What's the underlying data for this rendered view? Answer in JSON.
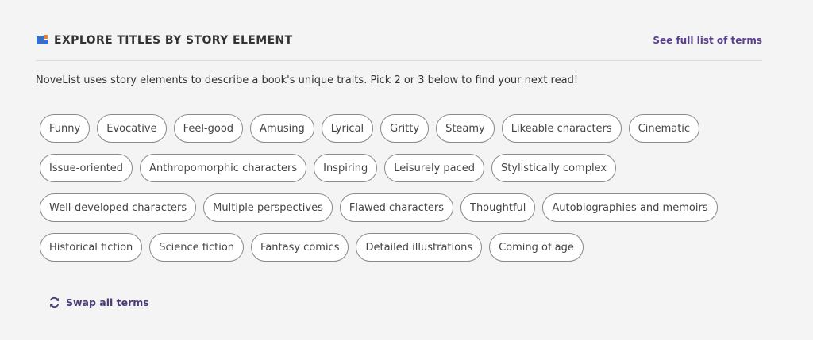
{
  "header": {
    "title": "EXPLORE TITLES BY STORY ELEMENT",
    "see_full_label": "See full list of terms",
    "icon": "book-icon"
  },
  "description": "NoveList uses story elements to describe a book's unique traits. Pick 2 or 3 below to find your next read!",
  "chips": {
    "row1": [
      "Funny",
      "Evocative",
      "Feel-good",
      "Amusing",
      "Lyrical",
      "Gritty",
      "Steamy",
      "Likeable characters",
      "Cinematic"
    ],
    "row2": [
      "Issue-oriented",
      "Anthropomorphic characters",
      "Inspiring",
      "Leisurely paced",
      "Stylistically complex"
    ],
    "row3": [
      "Well-developed characters",
      "Multiple perspectives",
      "Flawed characters",
      "Thoughtful",
      "Autobiographies and memoirs"
    ],
    "row4": [
      "Historical fiction",
      "Science fiction",
      "Fantasy comics",
      "Detailed illustrations",
      "Coming of age"
    ]
  },
  "swap": {
    "label": "Swap all terms",
    "icon": "refresh-icon"
  },
  "colors": {
    "accent": "#5b3f8f",
    "icon_blue": "#2f6fd6",
    "icon_orange": "#e8803a",
    "background": "#f4f4f4",
    "chip_border": "#8a8a8a"
  }
}
